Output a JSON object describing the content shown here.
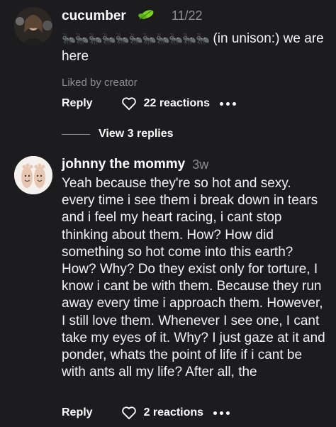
{
  "comment1": {
    "username": "cucumber",
    "time": "11/22",
    "ants": "🐜🐜🐜🐜🐜🐜🐜🐜🐜🐜🐜",
    "text_tail": " (in unison:) we are here",
    "liked": "Liked by creator",
    "reply_label": "Reply",
    "reactions": "22 reactions",
    "view_replies": "View 3 replies"
  },
  "comment2": {
    "username": "johnny the mommy",
    "time": "3w",
    "text": "Yeah because they're so hot and sexy. every time i see them i break down in tears and i feel my heart racing, i cant stop thinking about them. How? How did something so hot come into this earth? How? Why? Do they exist only for torture, I know i cant be with them. Because they run away every time i approach them. However, I still love them. Whenever I see one, I cant take my eyes of it. Why? I just gaze at it and ponder, whats the point of life if i cant be with ants all my life? After all, the",
    "reply_label": "Reply",
    "reactions": "2 reactions"
  },
  "icons": {
    "leaf": "leaf-icon",
    "heart": "heart-outline-icon",
    "more": "more-dots-icon"
  },
  "colors": {
    "background": "#1c1c1e",
    "muted": "#8e8e93",
    "leaf_green": "#7ed321"
  }
}
